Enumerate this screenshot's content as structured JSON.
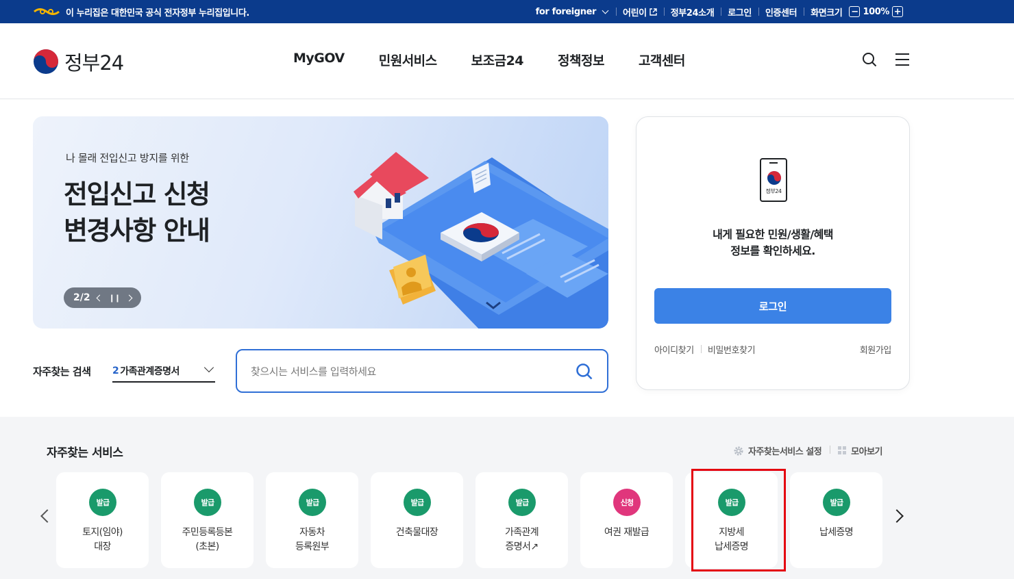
{
  "govbar": {
    "notice": "이 누리집은 대한민국 공식 전자정부 누리집입니다.",
    "links": {
      "foreigner": "for foreigner",
      "kids": "어린이",
      "about": "정부24소개",
      "login": "로그인",
      "cert": "인증센터",
      "screen_size": "화면크기",
      "zoom_minus": "−",
      "zoom_value": "100%",
      "zoom_plus": "+"
    }
  },
  "header": {
    "brand": "정부24",
    "menu": [
      "MyGOV",
      "민원서비스",
      "보조금24",
      "정책정보",
      "고객센터"
    ]
  },
  "banner": {
    "subtitle": "나 몰래 전입신고 방지를 위한",
    "title_line1": "전입신고 신청",
    "title_line2": "변경사항 안내",
    "pager": "2/2"
  },
  "login_card": {
    "phone_label": "정부24",
    "message_line1": "내게 필요한 민원/생활/혜택",
    "message_line2": "정보를 확인하세요.",
    "login_button": "로그인",
    "find_id": "아이디찾기",
    "find_password": "비밀번호찾기",
    "join": "회원가입"
  },
  "frequent_search": {
    "label": "자주찾는 검색",
    "rank": "2",
    "term": "가족관계증명서",
    "placeholder": "찾으시는 서비스를 입력하세요"
  },
  "services": {
    "title": "자주찾는 서비스",
    "settings": "자주찾는서비스 설정",
    "view_all": "모아보기",
    "items": [
      {
        "badge": "발급",
        "type": "issue",
        "line1": "토지(임야)",
        "line2": "대장"
      },
      {
        "badge": "발급",
        "type": "issue",
        "line1": "주민등록등본",
        "line2": "(초본)"
      },
      {
        "badge": "발급",
        "type": "issue",
        "line1": "자동차",
        "line2": "등록원부"
      },
      {
        "badge": "발급",
        "type": "issue",
        "line1": "건축물대장",
        "line2": ""
      },
      {
        "badge": "발급",
        "type": "issue",
        "line1": "가족관계",
        "line2": "증명서↗"
      },
      {
        "badge": "신청",
        "type": "apply",
        "line1": "여권 재발급",
        "line2": ""
      },
      {
        "badge": "발급",
        "type": "issue",
        "line1": "지방세",
        "line2": "납세증명"
      },
      {
        "badge": "발급",
        "type": "issue",
        "line1": "납세증명",
        "line2": ""
      }
    ]
  },
  "colors": {
    "gov_bar": "#0b3b8c",
    "primary": "#3b82e6",
    "issue_badge": "#1a9a6b",
    "apply_badge": "#e0367c",
    "highlight": "#e4000f"
  }
}
